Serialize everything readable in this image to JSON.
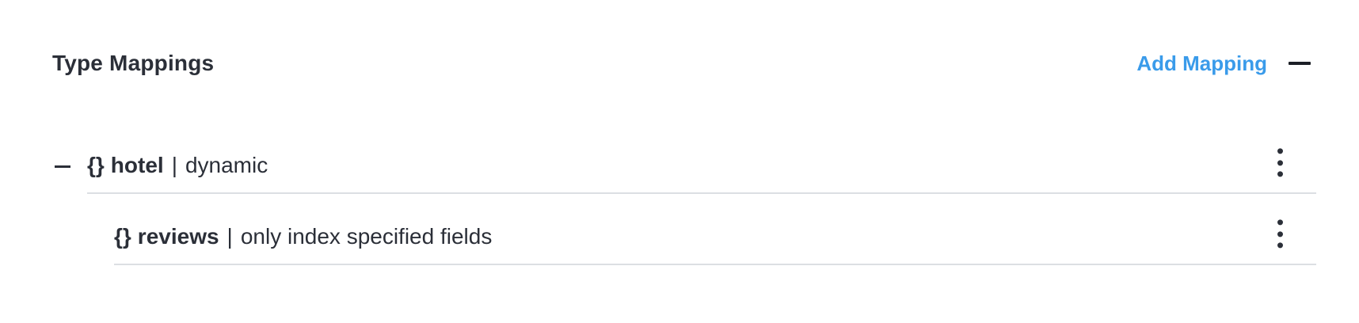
{
  "section": {
    "title": "Type Mappings",
    "add_mapping_label": "Add Mapping",
    "collapse_icon": "minus-icon"
  },
  "mappings": [
    {
      "braces": "{}",
      "name": "hotel",
      "separator": "|",
      "description": "dynamic",
      "expanded": true,
      "menu_icon": "kebab-menu-icon"
    },
    {
      "braces": "{}",
      "name": "reviews",
      "separator": "|",
      "description": "only index specified fields",
      "menu_icon": "kebab-menu-icon"
    }
  ]
}
